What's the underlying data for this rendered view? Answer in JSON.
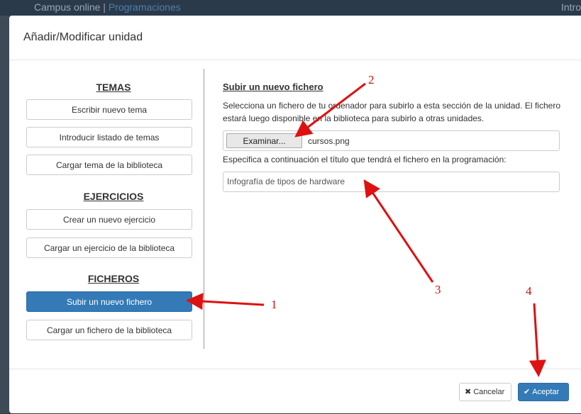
{
  "backdrop": {
    "title_left": "Campus online |",
    "title_link": "Programaciones",
    "title_right": "Intro"
  },
  "modal": {
    "title": "Añadir/Modificar unidad"
  },
  "left_panel": {
    "temas": {
      "heading": "TEMAS",
      "buttons": [
        "Escribir nuevo tema",
        "Introducir listado de temas",
        "Cargar tema de la biblioteca"
      ]
    },
    "ejercicios": {
      "heading": "EJERCICIOS",
      "buttons": [
        "Crear un nuevo ejercicio",
        "Cargar un ejercicio de la biblioteca"
      ]
    },
    "ficheros": {
      "heading": "FICHEROS",
      "buttons": [
        "Subir un nuevo fichero",
        "Cargar un fichero de la biblioteca"
      ]
    }
  },
  "right_panel": {
    "heading": "Subir un nuevo fichero",
    "description": "Selecciona un fichero de tu ordenador para subirlo a esta sección de la unidad. El fichero estará luego disponible en la biblioteca para subirlo a otras unidades.",
    "file_button": "Examinar...",
    "file_name": "cursos.png",
    "title_prompt": "Especifica a continuación el título que tendrá el fichero en la programación:",
    "title_value": "Infografía de tipos de hardware"
  },
  "footer": {
    "cancel_icon": "✖",
    "cancel_label": "Cancelar",
    "accept_icon": "✔",
    "accept_label": "Aceptar"
  },
  "annotations": {
    "n1": "1",
    "n2": "2",
    "n3": "3",
    "n4": "4"
  },
  "colors": {
    "primary": "#337ab7",
    "annotation": "#cc1111"
  }
}
